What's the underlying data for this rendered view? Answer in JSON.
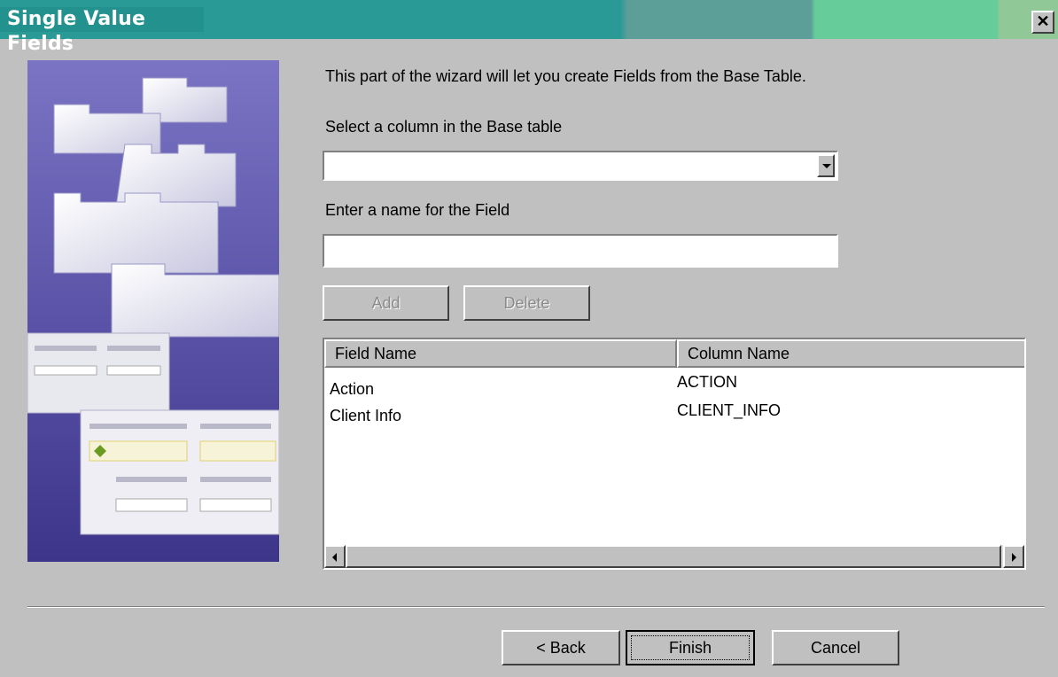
{
  "window": {
    "title": "Single Value Fields",
    "close_label": "✕"
  },
  "wizard": {
    "intro": "This part of the wizard will let you create Fields from the Base Table.",
    "column_label": "Select a column in the Base table",
    "column_value": "",
    "name_label": "Enter a name for the Field",
    "name_value": ""
  },
  "buttons": {
    "add": "Add",
    "delete": "Delete",
    "back": "< Back",
    "finish": "Finish",
    "cancel": "Cancel"
  },
  "table": {
    "columns": [
      "Field Name",
      "Column Name"
    ],
    "rows": [
      {
        "field": "Action",
        "column": "ACTION"
      },
      {
        "field": "Client Info",
        "column": "CLIENT_INFO"
      }
    ]
  },
  "icons": {
    "close": "close-icon",
    "dropdown": "dropdown-arrow-icon",
    "scroll_left": "scroll-left-icon",
    "scroll_right": "scroll-right-icon"
  },
  "colors": {
    "title_bg": "#2a9a96",
    "dialog_bg": "#c0c0c0"
  }
}
